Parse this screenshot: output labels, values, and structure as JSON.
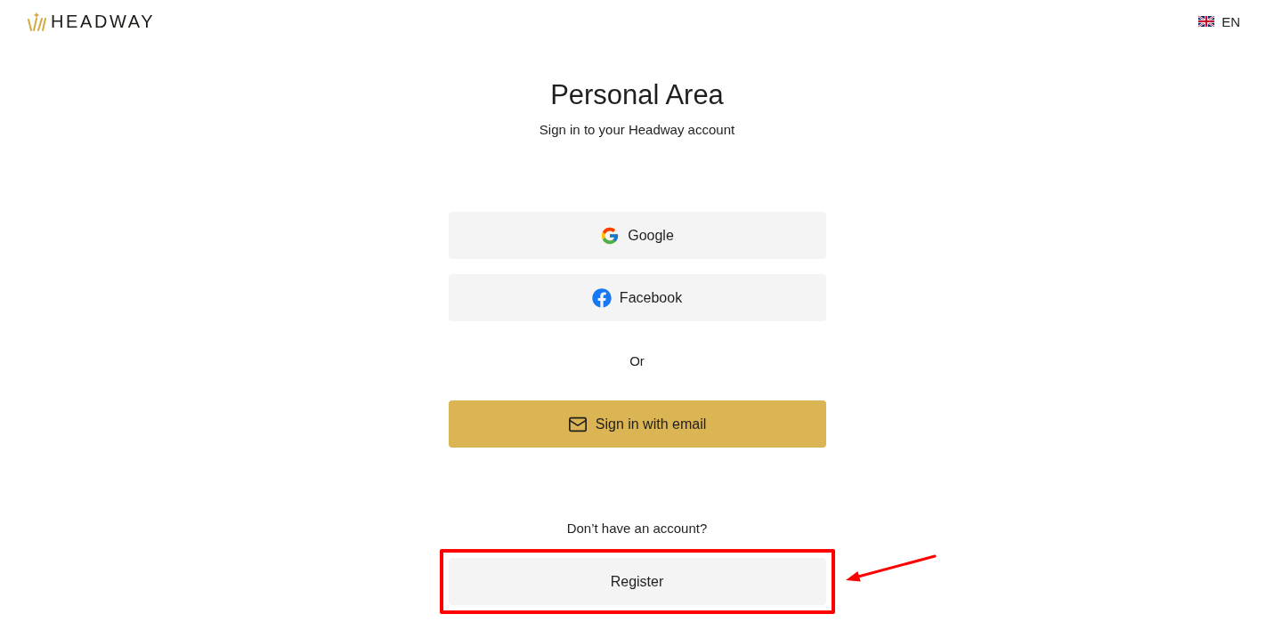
{
  "header": {
    "logo_text": "HEADWAY",
    "language": "EN"
  },
  "title": "Personal Area",
  "subtitle": "Sign in to your Headway account",
  "social_buttons": [
    {
      "kind": "google",
      "label": "Google"
    },
    {
      "kind": "facebook",
      "label": "Facebook"
    }
  ],
  "divider_text": "Or",
  "email_button": {
    "label": "Sign in with email"
  },
  "register_prompt": "Don’t have an account?",
  "register_button": {
    "label": "Register",
    "highlighted": true
  }
}
